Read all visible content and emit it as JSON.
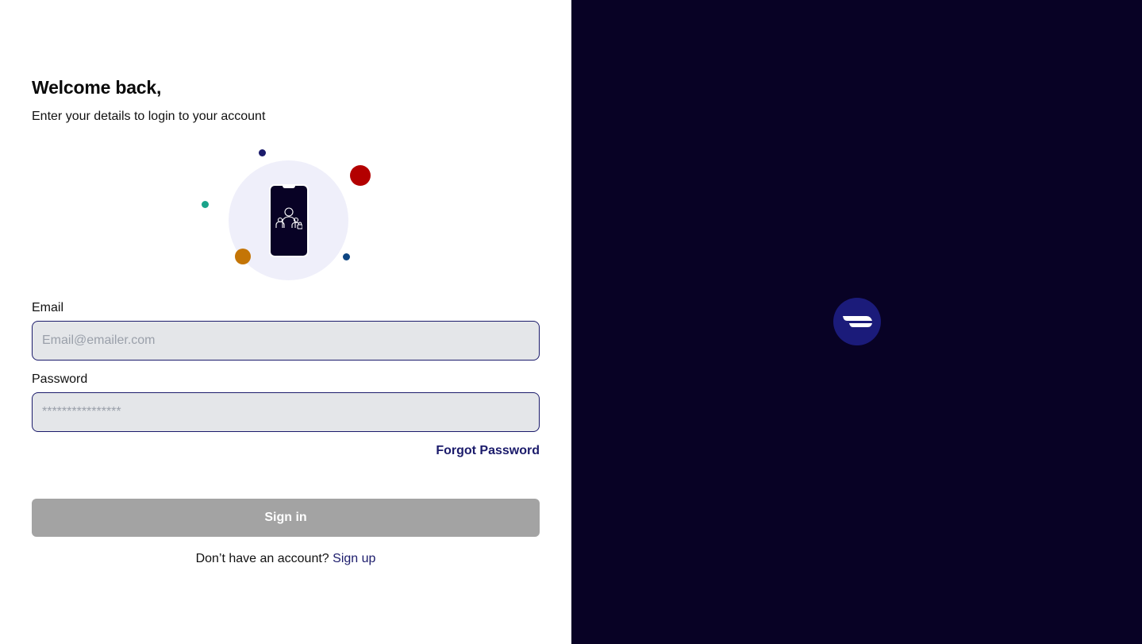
{
  "login": {
    "title": "Welcome back,",
    "subtitle": "Enter your details to login to your account",
    "email_label": "Email",
    "email_placeholder": "Email@emailer.com",
    "email_value": "",
    "password_label": "Password",
    "password_placeholder": "****************",
    "password_value": "",
    "forgot_label": "Forgot Password",
    "signin_label": "Sign in",
    "signup_prompt": "Don’t have an account?",
    "signup_link": "Sign up"
  },
  "illustration": {
    "icon": "phone-users-icon",
    "dot_colors": [
      "#1b1b6b",
      "#b30000",
      "#1aa38a",
      "#c47506",
      "#0d4582"
    ]
  },
  "brand": {
    "logo_icon": "brand-logo-icon"
  },
  "colors": {
    "accent": "#1b1b6b",
    "dark_panel": "#080225",
    "button_disabled": "#a3a3a3",
    "input_bg": "#e4e6e9"
  }
}
